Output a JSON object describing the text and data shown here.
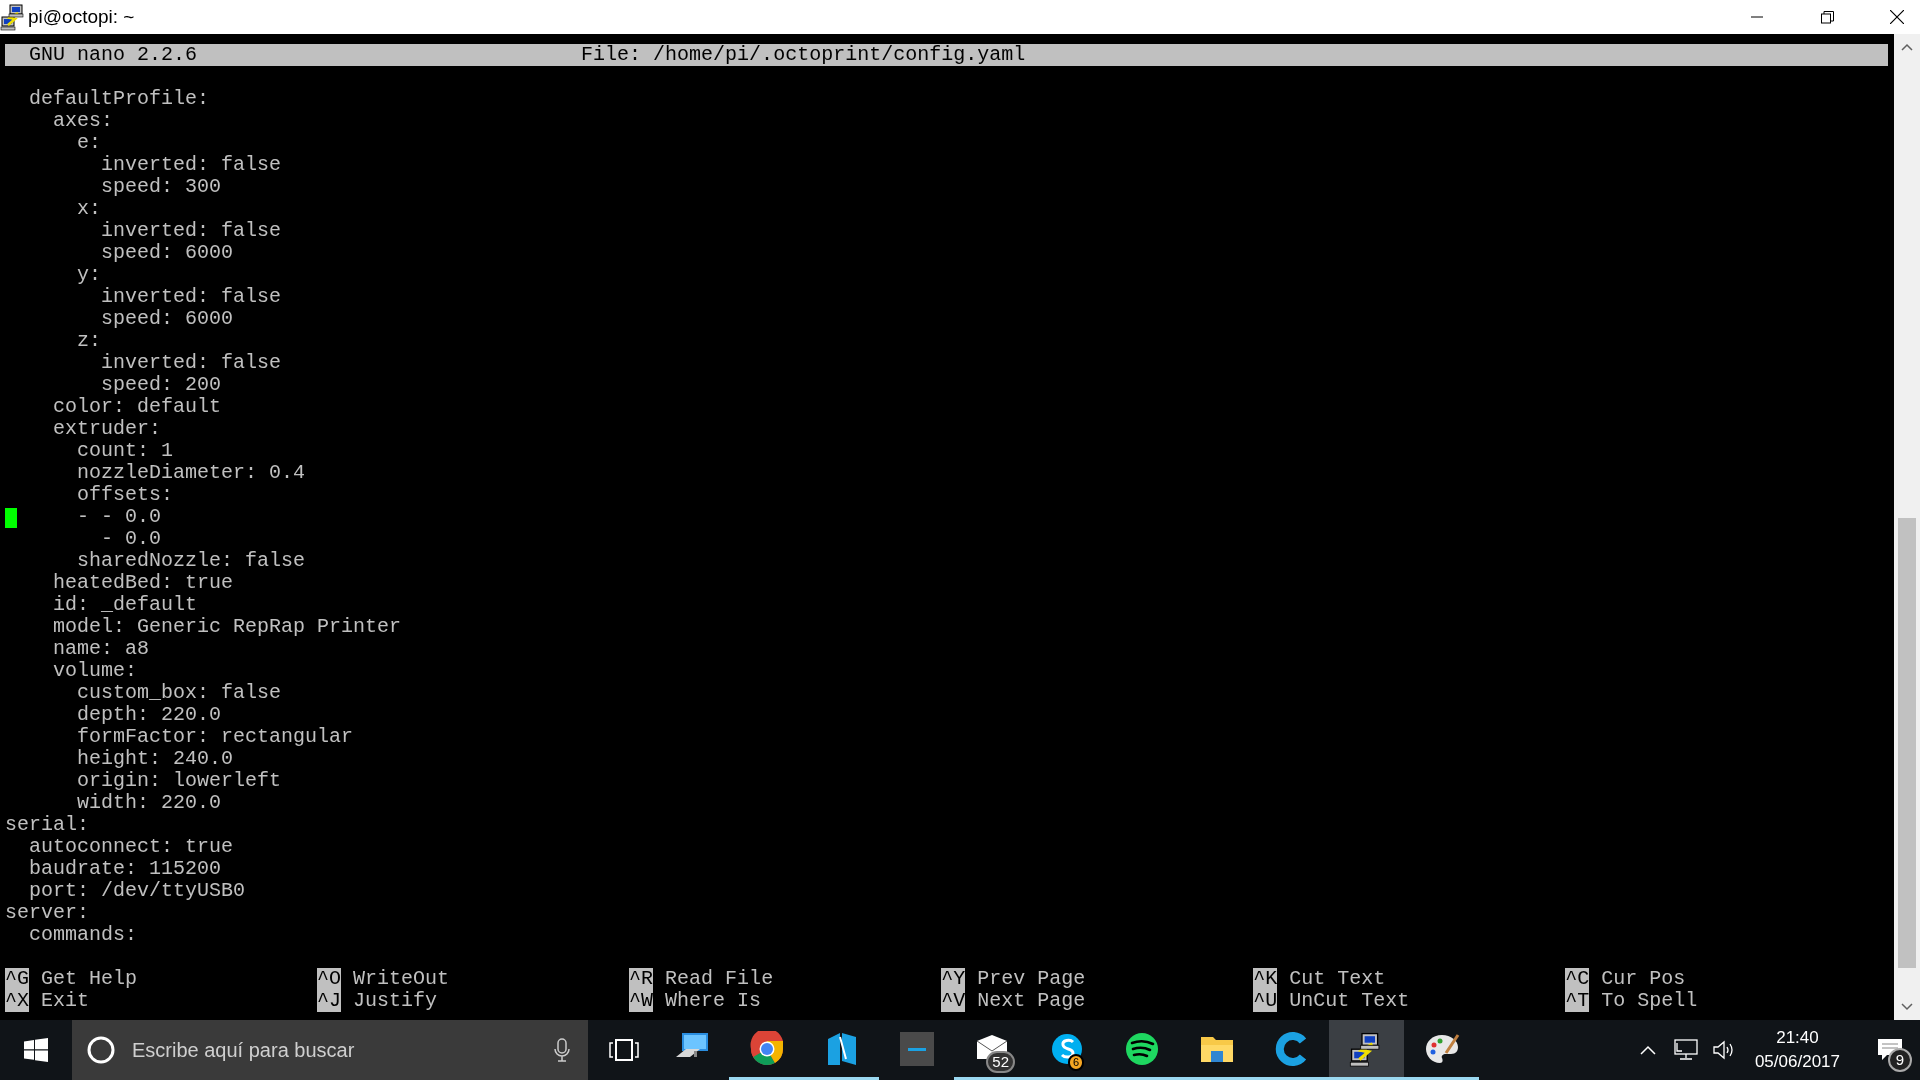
{
  "window": {
    "title": "pi@octopi: ~"
  },
  "nano": {
    "version": "GNU nano 2.2.6",
    "file": "File: /home/pi/.octoprint/config.yaml"
  },
  "lines": [
    {
      "text": "  defaultProfile:",
      "cursor": false
    },
    {
      "text": "    axes:",
      "cursor": false
    },
    {
      "text": "      e:",
      "cursor": false
    },
    {
      "text": "        inverted: false",
      "cursor": false
    },
    {
      "text": "        speed: 300",
      "cursor": false
    },
    {
      "text": "      x:",
      "cursor": false
    },
    {
      "text": "        inverted: false",
      "cursor": false
    },
    {
      "text": "        speed: 6000",
      "cursor": false
    },
    {
      "text": "      y:",
      "cursor": false
    },
    {
      "text": "        inverted: false",
      "cursor": false
    },
    {
      "text": "        speed: 6000",
      "cursor": false
    },
    {
      "text": "      z:",
      "cursor": false
    },
    {
      "text": "        inverted: false",
      "cursor": false
    },
    {
      "text": "        speed: 200",
      "cursor": false
    },
    {
      "text": "    color: default",
      "cursor": false
    },
    {
      "text": "    extruder:",
      "cursor": false
    },
    {
      "text": "      count: 1",
      "cursor": false
    },
    {
      "text": "      nozzleDiameter: 0.4",
      "cursor": false
    },
    {
      "text": "      offsets:",
      "cursor": false
    },
    {
      "text": "      - - 0.0",
      "cursor": true
    },
    {
      "text": "        - 0.0",
      "cursor": false
    },
    {
      "text": "      sharedNozzle: false",
      "cursor": false
    },
    {
      "text": "    heatedBed: true",
      "cursor": false
    },
    {
      "text": "    id: _default",
      "cursor": false
    },
    {
      "text": "    model: Generic RepRap Printer",
      "cursor": false
    },
    {
      "text": "    name: a8",
      "cursor": false
    },
    {
      "text": "    volume:",
      "cursor": false
    },
    {
      "text": "      custom_box: false",
      "cursor": false
    },
    {
      "text": "      depth: 220.0",
      "cursor": false
    },
    {
      "text": "      formFactor: rectangular",
      "cursor": false
    },
    {
      "text": "      height: 240.0",
      "cursor": false
    },
    {
      "text": "      origin: lowerleft",
      "cursor": false
    },
    {
      "text": "      width: 220.0",
      "cursor": false
    },
    {
      "text": "serial:",
      "cursor": false
    },
    {
      "text": "  autoconnect: true",
      "cursor": false
    },
    {
      "text": "  baudrate: 115200",
      "cursor": false
    },
    {
      "text": "  port: /dev/ttyUSB0",
      "cursor": false
    },
    {
      "text": "server:",
      "cursor": false
    },
    {
      "text": "  commands:",
      "cursor": false
    }
  ],
  "shortcuts": [
    [
      {
        "key": "^G",
        "label": "Get Help"
      },
      {
        "key": "^O",
        "label": "WriteOut"
      },
      {
        "key": "^R",
        "label": "Read File"
      },
      {
        "key": "^Y",
        "label": "Prev Page"
      },
      {
        "key": "^K",
        "label": "Cut Text"
      },
      {
        "key": "^C",
        "label": "Cur Pos"
      }
    ],
    [
      {
        "key": "^X",
        "label": "Exit"
      },
      {
        "key": "^J",
        "label": "Justify"
      },
      {
        "key": "^W",
        "label": "Where Is"
      },
      {
        "key": "^V",
        "label": "Next Page"
      },
      {
        "key": "^U",
        "label": "UnCut Text"
      },
      {
        "key": "^T",
        "label": "To Spell"
      }
    ]
  ],
  "taskbar": {
    "search": {
      "placeholder": "Escribe aquí para buscar"
    },
    "apps": [
      {
        "running": false,
        "selected": false
      },
      {
        "running": true,
        "selected": false
      },
      {
        "running": true,
        "selected": false
      },
      {
        "running": false,
        "selected": false
      },
      {
        "running": true,
        "selected": false,
        "badge": "52"
      },
      {
        "running": true,
        "selected": false,
        "badge": "6"
      },
      {
        "running": true,
        "selected": false
      },
      {
        "running": true,
        "selected": false
      },
      {
        "running": true,
        "selected": false
      },
      {
        "running": true,
        "selected": true
      },
      {
        "running": true,
        "selected": false
      }
    ],
    "time": "21:40",
    "date": "05/06/2017",
    "notifications": "9"
  }
}
